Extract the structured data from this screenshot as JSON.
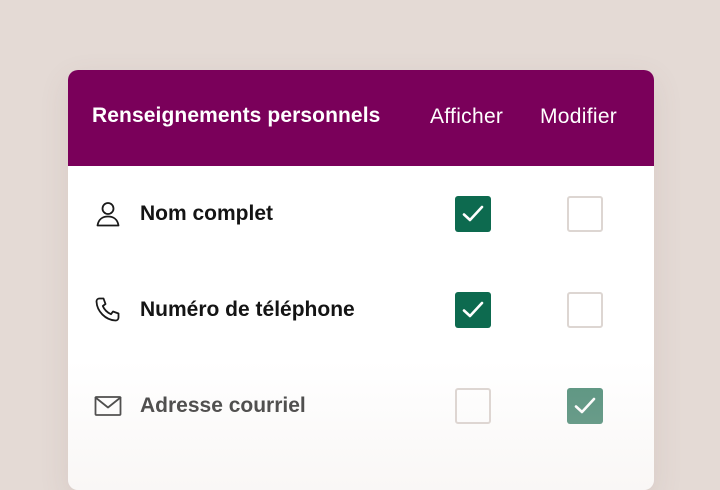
{
  "header": {
    "title": "Renseignements personnels",
    "view_label": "Afficher",
    "edit_label": "Modifier"
  },
  "rows": [
    {
      "label": "Nom complet",
      "icon": "user-icon",
      "view": true,
      "edit": false
    },
    {
      "label": "Numéro de téléphone",
      "icon": "phone-icon",
      "view": true,
      "edit": false
    },
    {
      "label": "Adresse courriel",
      "icon": "mail-icon",
      "view": false,
      "edit": true
    }
  ],
  "colors": {
    "header_bg": "#7a005a",
    "checkbox_on": "#0d6a4f",
    "page_bg": "#e4dad5"
  }
}
